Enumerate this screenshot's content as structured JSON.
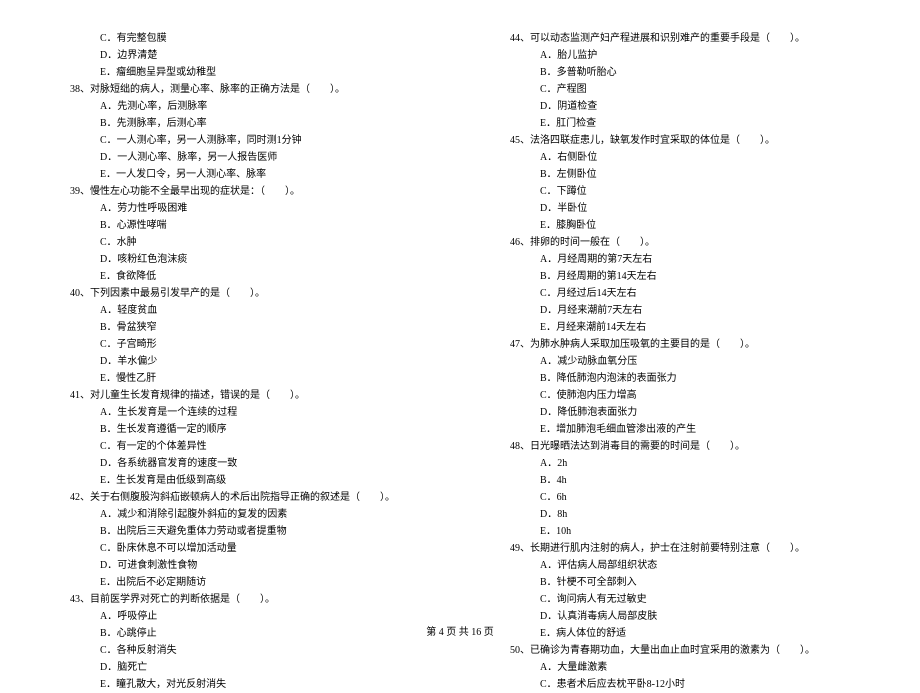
{
  "left_column": [
    {
      "type": "option",
      "text": "C．有完整包膜"
    },
    {
      "type": "option",
      "text": "D．边界清楚"
    },
    {
      "type": "option",
      "text": "E．瘤细胞呈异型或幼稚型"
    },
    {
      "type": "question",
      "text": "38、对脉短绌的病人，测量心率、脉率的正确方法是（　　）。"
    },
    {
      "type": "option",
      "text": "A．先测心率，后测脉率"
    },
    {
      "type": "option",
      "text": "B．先测脉率，后测心率"
    },
    {
      "type": "option",
      "text": "C．一人测心率，另一人测脉率，同时测1分钟"
    },
    {
      "type": "option",
      "text": "D．一人测心率、脉率，另一人报告医师"
    },
    {
      "type": "option",
      "text": "E．一人发口令，另一人测心率、脉率"
    },
    {
      "type": "question",
      "text": "39、慢性左心功能不全最早出现的症状是：（　　）。"
    },
    {
      "type": "option",
      "text": "A．劳力性呼吸困难"
    },
    {
      "type": "option",
      "text": "B．心源性哮喘"
    },
    {
      "type": "option",
      "text": "C．水肿"
    },
    {
      "type": "option",
      "text": "D．咳粉红色泡沫痰"
    },
    {
      "type": "option",
      "text": "E．食欲降低"
    },
    {
      "type": "question",
      "text": "40、下列因素中最易引发早产的是（　　）。"
    },
    {
      "type": "option",
      "text": "A．轻度贫血"
    },
    {
      "type": "option",
      "text": "B．骨盆狭窄"
    },
    {
      "type": "option",
      "text": "C．子宫畸形"
    },
    {
      "type": "option",
      "text": "D．羊水偏少"
    },
    {
      "type": "option",
      "text": "E．慢性乙肝"
    },
    {
      "type": "question",
      "text": "41、对儿童生长发育规律的描述，错误的是（　　）。"
    },
    {
      "type": "option",
      "text": "A．生长发育是一个连续的过程"
    },
    {
      "type": "option",
      "text": "B．生长发育遵循一定的顺序"
    },
    {
      "type": "option",
      "text": "C．有一定的个体差异性"
    },
    {
      "type": "option",
      "text": "D．各系统器官发育的速度一致"
    },
    {
      "type": "option",
      "text": "E．生长发育是由低级到高级"
    },
    {
      "type": "question",
      "text": "42、关于右侧腹股沟斜疝嵌顿病人的术后出院指导正确的叙述是（　　）。"
    },
    {
      "type": "option",
      "text": "A．减少和消除引起腹外斜疝的复发的因素"
    },
    {
      "type": "option",
      "text": "B．出院后三天避免重体力劳动或者提重物"
    },
    {
      "type": "option",
      "text": "C．卧床休息不可以增加活动量"
    },
    {
      "type": "option",
      "text": "D．可进食刺激性食物"
    },
    {
      "type": "option",
      "text": "E．出院后不必定期随访"
    },
    {
      "type": "question",
      "text": "43、目前医学界对死亡的判断依据是（　　）。"
    },
    {
      "type": "option",
      "text": "A．呼吸停止"
    },
    {
      "type": "option",
      "text": "B．心跳停止"
    },
    {
      "type": "option",
      "text": "C．各种反射消失"
    },
    {
      "type": "option",
      "text": "D．脑死亡"
    },
    {
      "type": "option",
      "text": "E．瞳孔散大，对光反射消失"
    }
  ],
  "right_column": [
    {
      "type": "question",
      "text": "44、可以动态监测产妇产程进展和识别难产的重要手段是（　　）。"
    },
    {
      "type": "option",
      "text": "A．胎儿监护"
    },
    {
      "type": "option",
      "text": "B．多普勒听胎心"
    },
    {
      "type": "option",
      "text": "C．产程图"
    },
    {
      "type": "option",
      "text": "D．阴道检查"
    },
    {
      "type": "option",
      "text": "E．肛门检查"
    },
    {
      "type": "question",
      "text": "45、法洛四联症患儿，缺氧发作时宜采取的体位是（　　）。"
    },
    {
      "type": "option",
      "text": "A．右侧卧位"
    },
    {
      "type": "option",
      "text": "B．左侧卧位"
    },
    {
      "type": "option",
      "text": "C．下蹲位"
    },
    {
      "type": "option",
      "text": "D．半卧位"
    },
    {
      "type": "option",
      "text": "E．膝胸卧位"
    },
    {
      "type": "question",
      "text": "46、排卵的时间一般在（　　）。"
    },
    {
      "type": "option",
      "text": "A．月经周期的第7天左右"
    },
    {
      "type": "option",
      "text": "B．月经周期的第14天左右"
    },
    {
      "type": "option",
      "text": "C．月经过后14天左右"
    },
    {
      "type": "option",
      "text": "D．月经来潮前7天左右"
    },
    {
      "type": "option",
      "text": "E．月经来潮前14天左右"
    },
    {
      "type": "question",
      "text": "47、为肺水肿病人采取加压吸氧的主要目的是（　　）。"
    },
    {
      "type": "option",
      "text": "A．减少动脉血氧分压"
    },
    {
      "type": "option",
      "text": "B．降低肺泡内泡沫的表面张力"
    },
    {
      "type": "option",
      "text": "C．使肺泡内压力增高"
    },
    {
      "type": "option",
      "text": "D．降低肺泡表面张力"
    },
    {
      "type": "option",
      "text": "E．增加肺泡毛细血管渗出液的产生"
    },
    {
      "type": "question",
      "text": "48、日光曝晒法达到消毒目的需要的时间是（　　）。"
    },
    {
      "type": "option",
      "text": "A．2h"
    },
    {
      "type": "option",
      "text": "B．4h"
    },
    {
      "type": "option",
      "text": "C．6h"
    },
    {
      "type": "option",
      "text": "D．8h"
    },
    {
      "type": "option",
      "text": "E．10h"
    },
    {
      "type": "question",
      "text": "49、长期进行肌内注射的病人，护士在注射前要特别注意（　　）。"
    },
    {
      "type": "option",
      "text": "A．评估病人局部组织状态"
    },
    {
      "type": "option",
      "text": "B．针梗不可全部刺入"
    },
    {
      "type": "option",
      "text": "C．询问病人有无过敏史"
    },
    {
      "type": "option",
      "text": "D．认真消毒病人局部皮肤"
    },
    {
      "type": "option",
      "text": "E．病人体位的舒适"
    },
    {
      "type": "question",
      "text": "50、已确诊为青春期功血，大量出血止血时宜采用的激素为（　　）。"
    },
    {
      "type": "option",
      "text": "A．大量雌激素"
    },
    {
      "type": "option",
      "text": "C．患者术后应去枕平卧8-12小时"
    }
  ],
  "footer": "第 4 页 共 16 页"
}
